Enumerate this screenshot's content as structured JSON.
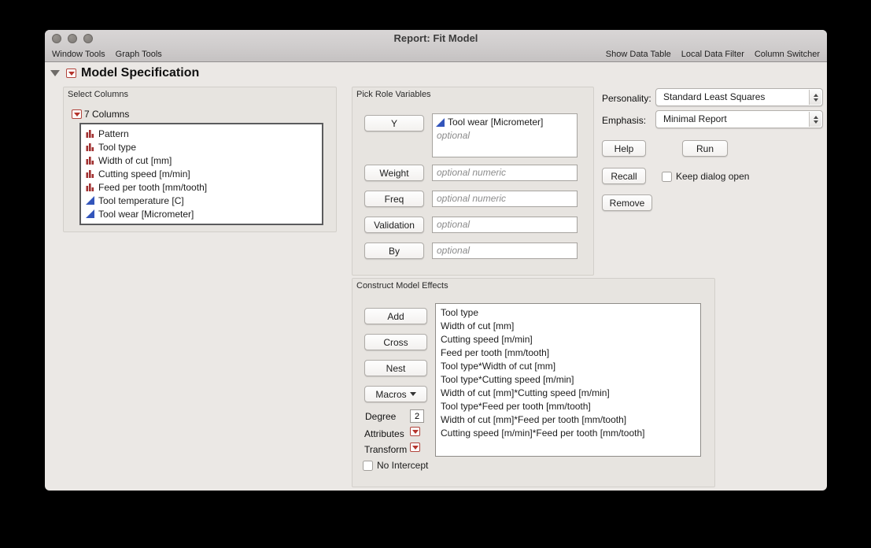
{
  "window": {
    "title": "Report: Fit Model",
    "toolbar_left": [
      "Window Tools",
      "Graph Tools"
    ],
    "toolbar_right": [
      "Show Data Table",
      "Local Data Filter",
      "Column Switcher"
    ]
  },
  "outline": {
    "title": "Model Specification"
  },
  "select_columns": {
    "panel_title": "Select Columns",
    "count_label": "7 Columns",
    "columns": [
      {
        "name": "Pattern",
        "type": "nominal"
      },
      {
        "name": "Tool type",
        "type": "nominal"
      },
      {
        "name": "Width of cut [mm]",
        "type": "nominal"
      },
      {
        "name": "Cutting speed [m/min]",
        "type": "nominal"
      },
      {
        "name": "Feed per tooth [mm/tooth]",
        "type": "nominal"
      },
      {
        "name": "Tool temperature [C]",
        "type": "continuous"
      },
      {
        "name": "Tool wear [Micrometer]",
        "type": "continuous"
      }
    ]
  },
  "pick_roles": {
    "panel_title": "Pick Role Variables",
    "y_button": "Y",
    "y_value": "Tool wear [Micrometer]",
    "y_placeholder": "optional",
    "weight_button": "Weight",
    "weight_placeholder": "optional numeric",
    "freq_button": "Freq",
    "freq_placeholder": "optional numeric",
    "validation_button": "Validation",
    "validation_placeholder": "optional",
    "by_button": "By",
    "by_placeholder": "optional"
  },
  "effects": {
    "panel_title": "Construct Model Effects",
    "add_button": "Add",
    "cross_button": "Cross",
    "nest_button": "Nest",
    "macros_button": "Macros",
    "degree_label": "Degree",
    "degree_value": "2",
    "attributes_label": "Attributes",
    "transform_label": "Transform",
    "no_intercept_label": "No Intercept",
    "items": [
      "Tool type",
      "Width of cut [mm]",
      "Cutting speed [m/min]",
      "Feed per tooth [mm/tooth]",
      "Tool type*Width of cut [mm]",
      "Tool type*Cutting speed [m/min]",
      "Width of cut [mm]*Cutting speed [m/min]",
      "Tool type*Feed per tooth [mm/tooth]",
      "Width of cut [mm]*Feed per tooth [mm/tooth]",
      "Cutting speed [m/min]*Feed per tooth [mm/tooth]"
    ]
  },
  "actions": {
    "personality_label": "Personality:",
    "personality_value": "Standard Least Squares",
    "emphasis_label": "Emphasis:",
    "emphasis_value": "Minimal Report",
    "help_button": "Help",
    "run_button": "Run",
    "recall_button": "Recall",
    "keep_dialog_open_label": "Keep dialog open",
    "remove_button": "Remove"
  },
  "colors": {
    "accent_red": "#b5342c",
    "continuous_blue": "#3355bb",
    "nominal_red": "#a03030"
  }
}
